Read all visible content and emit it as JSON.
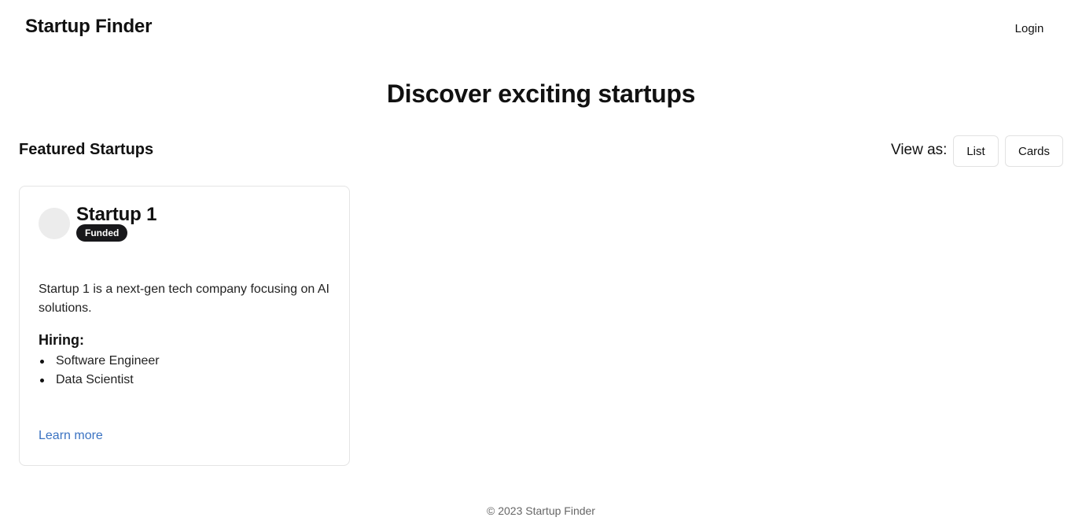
{
  "header": {
    "brand": "Startup Finder",
    "login_label": "Login"
  },
  "hero": {
    "title": "Discover exciting startups"
  },
  "section": {
    "title": "Featured Startups",
    "view_as_label": "View as:",
    "view_options": [
      "List",
      "Cards"
    ]
  },
  "startups": [
    {
      "name": "Startup 1",
      "badge": "Funded",
      "description": "Startup 1 is a next-gen tech company focusing on AI solutions.",
      "hiring_title": "Hiring:",
      "jobs": [
        "Software Engineer",
        "Data Scientist"
      ],
      "link_label": "Learn more"
    }
  ],
  "footer": {
    "text": "© 2023 Startup Finder"
  }
}
